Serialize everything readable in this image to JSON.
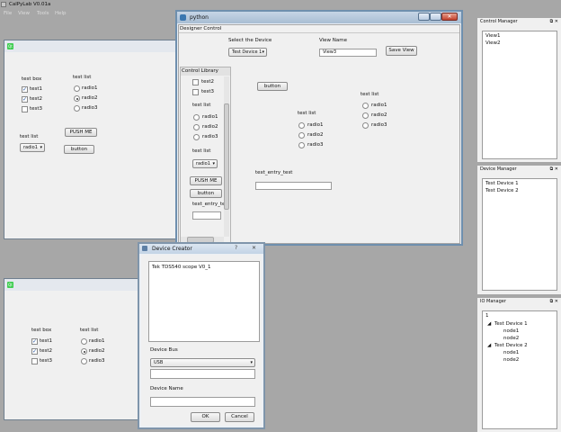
{
  "app": {
    "title": "CalPyLab V0.01a",
    "menu": [
      "File",
      "View",
      "Tools",
      "Help"
    ]
  },
  "qt_window_1": {
    "checkbox_title": "test box",
    "checkboxes": [
      {
        "label": "test1",
        "checked": true
      },
      {
        "label": "test2",
        "checked": true
      },
      {
        "label": "test3",
        "checked": false
      }
    ],
    "radio_title": "test list",
    "radios": [
      {
        "label": "radio1",
        "selected": false
      },
      {
        "label": "radio2",
        "selected": true
      },
      {
        "label": "radio3",
        "selected": false
      }
    ],
    "push_label": "PUSH ME",
    "combo_title": "test list",
    "combo_value": "radio1",
    "button_label": "button"
  },
  "qt_window_2": {
    "checkbox_title": "test box",
    "checkboxes": [
      {
        "label": "test1",
        "checked": true
      },
      {
        "label": "test2",
        "checked": true
      },
      {
        "label": "test3",
        "checked": false
      }
    ],
    "radio_title": "test list",
    "radios": [
      {
        "label": "radio1",
        "selected": false
      },
      {
        "label": "radio2",
        "selected": true
      },
      {
        "label": "radio3",
        "selected": false
      }
    ]
  },
  "python_window": {
    "title": "python",
    "designer_control": {
      "title": "Designer Control",
      "device_label": "Select the Device",
      "device_value": "Test Device 1",
      "view_name_label": "View Name",
      "view_name_value": "View3",
      "save_view_label": "Save View"
    },
    "control_library": {
      "title": "Control Library",
      "checkboxes": [
        "test2",
        "test3"
      ],
      "radio_title": "test list",
      "radios": [
        "radio1",
        "radio2",
        "radio3"
      ],
      "combo_title": "test list",
      "combo_value": "radio1",
      "push_label": "PUSH ME",
      "button_label": "button",
      "entry_label": "text_entry_test"
    },
    "canvas": {
      "button_label": "button",
      "list1_title": "test list",
      "list1_radios": [
        "radio1",
        "radio2",
        "radio3"
      ],
      "list2_title": "test list",
      "list2_radios": [
        "radio1",
        "radio2",
        "radio3"
      ],
      "entry_label": "text_entry_test"
    }
  },
  "device_creator": {
    "title": "Device Creator",
    "devices": [
      "Tek TDS540 scope V0_1"
    ],
    "bus_label": "Device Bus",
    "bus_value": "USB",
    "name_label": "Device Name",
    "ok_label": "OK",
    "cancel_label": "Cancel"
  },
  "control_manager": {
    "title": "Control Manager",
    "items": [
      "View1",
      "View2"
    ]
  },
  "device_manager": {
    "title": "Device Manager",
    "items": [
      "Test Device 1",
      "Test Device 2"
    ]
  },
  "io_manager": {
    "title": "IO Manager",
    "header": "1",
    "tree": [
      {
        "label": "Test Device 1",
        "children": [
          "node1",
          "node2"
        ]
      },
      {
        "label": "Test Device 2",
        "children": [
          "node1",
          "node2"
        ]
      }
    ]
  }
}
